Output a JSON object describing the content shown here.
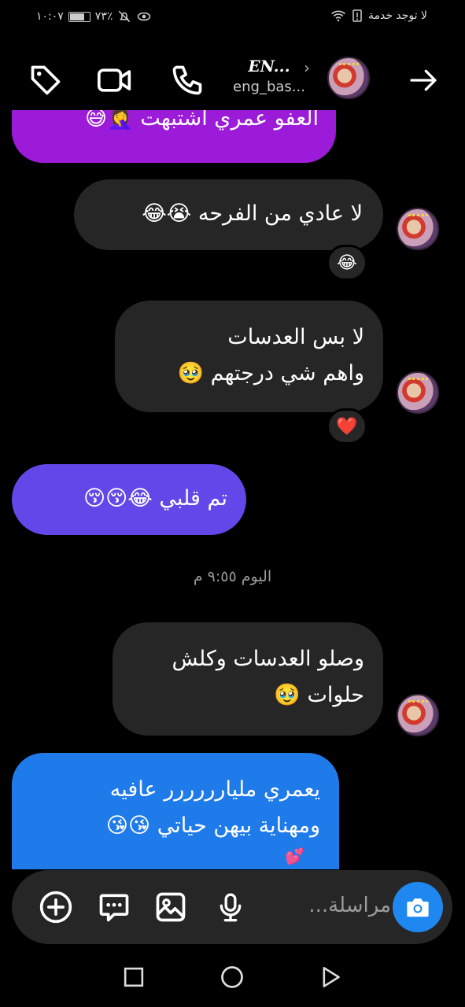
{
  "status_bar": {
    "time": "١٠:٠٧",
    "battery": "٧٣٪",
    "carrier": "لا توجد خدمة"
  },
  "header": {
    "display_name": "EN...",
    "username": "eng_bas...",
    "icons": [
      "tag-icon",
      "video-call-icon",
      "phone-icon",
      "forward-arrow-icon"
    ]
  },
  "messages": [
    {
      "text": "العفو عمري اشتبهت 🤦‍♀️😅",
      "direction": "sent",
      "color": "#9c1bd9"
    },
    {
      "text": "لا عادي من الفرحه 😭😂",
      "direction": "received",
      "reaction": "😂"
    },
    {
      "lines": [
        "لا بس العدسات",
        "واهم شي درجتهم 🥹"
      ],
      "direction": "received",
      "reaction": "❤️"
    },
    {
      "text": "تم قلبي 😂😚😚",
      "direction": "sent",
      "color": "#6447e8"
    },
    {
      "timestamp": "اليوم ٩:٥٥ م"
    },
    {
      "lines": [
        "وصلو العدسات وكلش",
        "حلوات 🥹"
      ],
      "direction": "received"
    },
    {
      "lines": [
        "يعمري مليارررررر عافيه",
        "ومهناية بيهن حياتي 😘😘",
        "💕"
      ],
      "direction": "sent",
      "color": "#1f7bea"
    }
  ],
  "composer": {
    "placeholder": "مراسلة...",
    "icons": [
      "add-icon",
      "sticker-icon",
      "gallery-icon",
      "microphone-icon",
      "camera-icon"
    ]
  },
  "nav_bar": {
    "icons": [
      "recents-icon",
      "home-icon",
      "back-icon"
    ]
  },
  "colors": {
    "background": "#000000",
    "received_bubble": "#262626",
    "camera_button": "#1e88f0"
  }
}
